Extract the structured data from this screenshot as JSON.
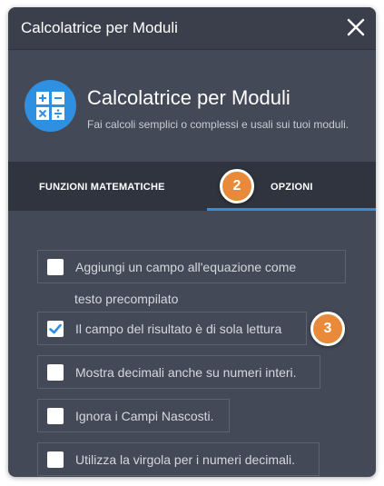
{
  "window": {
    "title": "Calcolatrice per Moduli",
    "close_icon": "close-icon"
  },
  "app": {
    "name": "Calcolatrice per Moduli",
    "description": "Fai calcoli semplici o complessi e usali sui tuoi moduli.",
    "icon": "calculator-icon",
    "icon_color": "#2f8fe0"
  },
  "tabs": [
    {
      "label": "FUNZIONI MATEMATICHE",
      "active": false
    },
    {
      "label": "OPZIONI",
      "active": true
    }
  ],
  "badges": {
    "tabs_step": "2",
    "readonly_step": "3",
    "color": "#e88a3a"
  },
  "options": [
    {
      "label_line1": "Aggiungi un campo all'equazione come",
      "label_line2": "testo precompilato",
      "checked": false
    },
    {
      "label": "Il campo del risultato è di sola lettura",
      "checked": true
    },
    {
      "label": "Mostra decimali anche su numeri interi.",
      "checked": false
    },
    {
      "label": "Ignora i Campi Nascosti.",
      "checked": false
    },
    {
      "label": "Utilizza la virgola per i numeri decimali.",
      "checked": false
    }
  ],
  "colors": {
    "accent": "#2f8fe0",
    "panel": "#434956",
    "tabbar": "#2f343e"
  }
}
